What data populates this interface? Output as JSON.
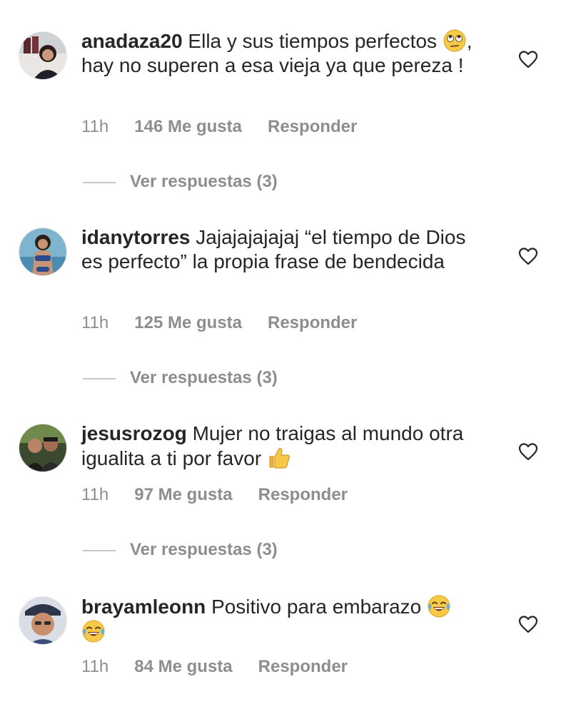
{
  "comments": [
    {
      "username": "anadaza20",
      "text_before_emoji": "Ella y sus tiempos perfectos",
      "emoji": "face-with-rolling-eyes",
      "text_after_emoji": ", hay no superen a esa vieja ya que pereza !",
      "time": "11h",
      "likes": "146 Me gusta",
      "reply": "Responder",
      "view_replies": "Ver respuestas (3)"
    },
    {
      "username": "idanytorres",
      "text": "Jajajajajajaj “el tiempo de Dios es perfecto”  la propia frase de bendecida",
      "time": "11h",
      "likes": "125 Me gusta",
      "reply": "Responder",
      "view_replies": "Ver respuestas (3)"
    },
    {
      "username": "jesusrozog",
      "text": "Mujer no traigas al mundo otra igualita a ti por favor",
      "emoji": "thumbs-up",
      "time": "11h",
      "likes": "97 Me gusta",
      "reply": "Responder",
      "view_replies": "Ver respuestas (3)"
    },
    {
      "username": "brayamleonn",
      "text": "Positivo para embarazo",
      "emoji": "face-with-tears-of-joy",
      "emoji_count": 2,
      "time": "11h",
      "likes": "84 Me gusta",
      "reply": "Responder"
    }
  ],
  "colors": {
    "text": "#262626",
    "secondary": "#8e8e8e",
    "background": "#ffffff"
  }
}
